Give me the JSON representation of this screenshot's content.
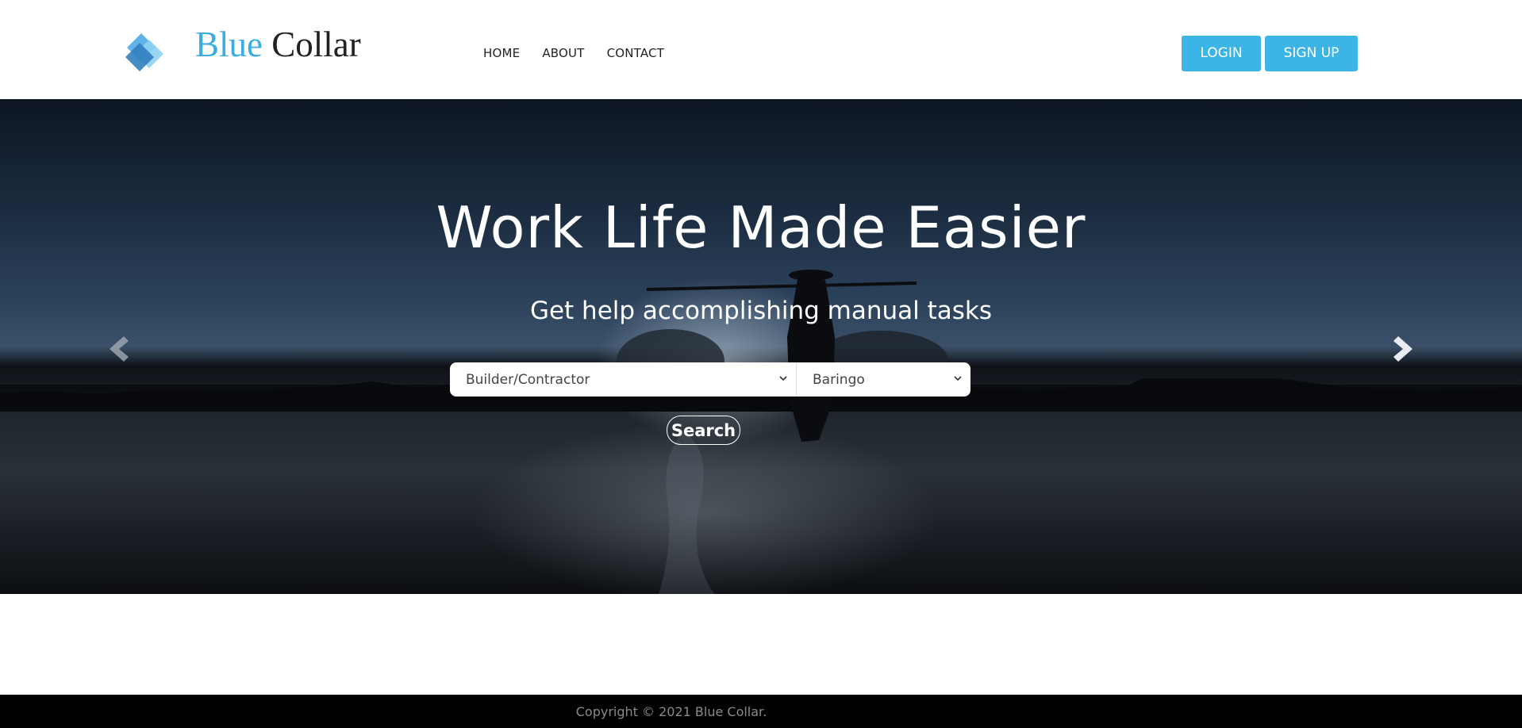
{
  "header": {
    "brand_part1": "Blue",
    "brand_part2": "Collar",
    "logo_icon": "stacked-diamonds-icon",
    "nav": [
      {
        "label": "HOME"
      },
      {
        "label": "ABOUT"
      },
      {
        "label": "CONTACT"
      }
    ],
    "login_label": "LOGIN",
    "signup_label": "SIGN UP"
  },
  "hero": {
    "title": "Work Life Made Easier",
    "subtitle": "Get help accomplishing manual tasks",
    "trade_select": {
      "value": "Builder/Contractor"
    },
    "county_select": {
      "value": "Baringo"
    },
    "search_label": "Search",
    "prev_icon": "chevron-left-icon",
    "next_icon": "chevron-right-icon"
  },
  "footer": {
    "copyright": "Copyright © 2021 Blue Collar."
  },
  "colors": {
    "accent": "#3cb4e6",
    "brand_blue": "#3aaee4",
    "footer_bg": "#000000"
  }
}
